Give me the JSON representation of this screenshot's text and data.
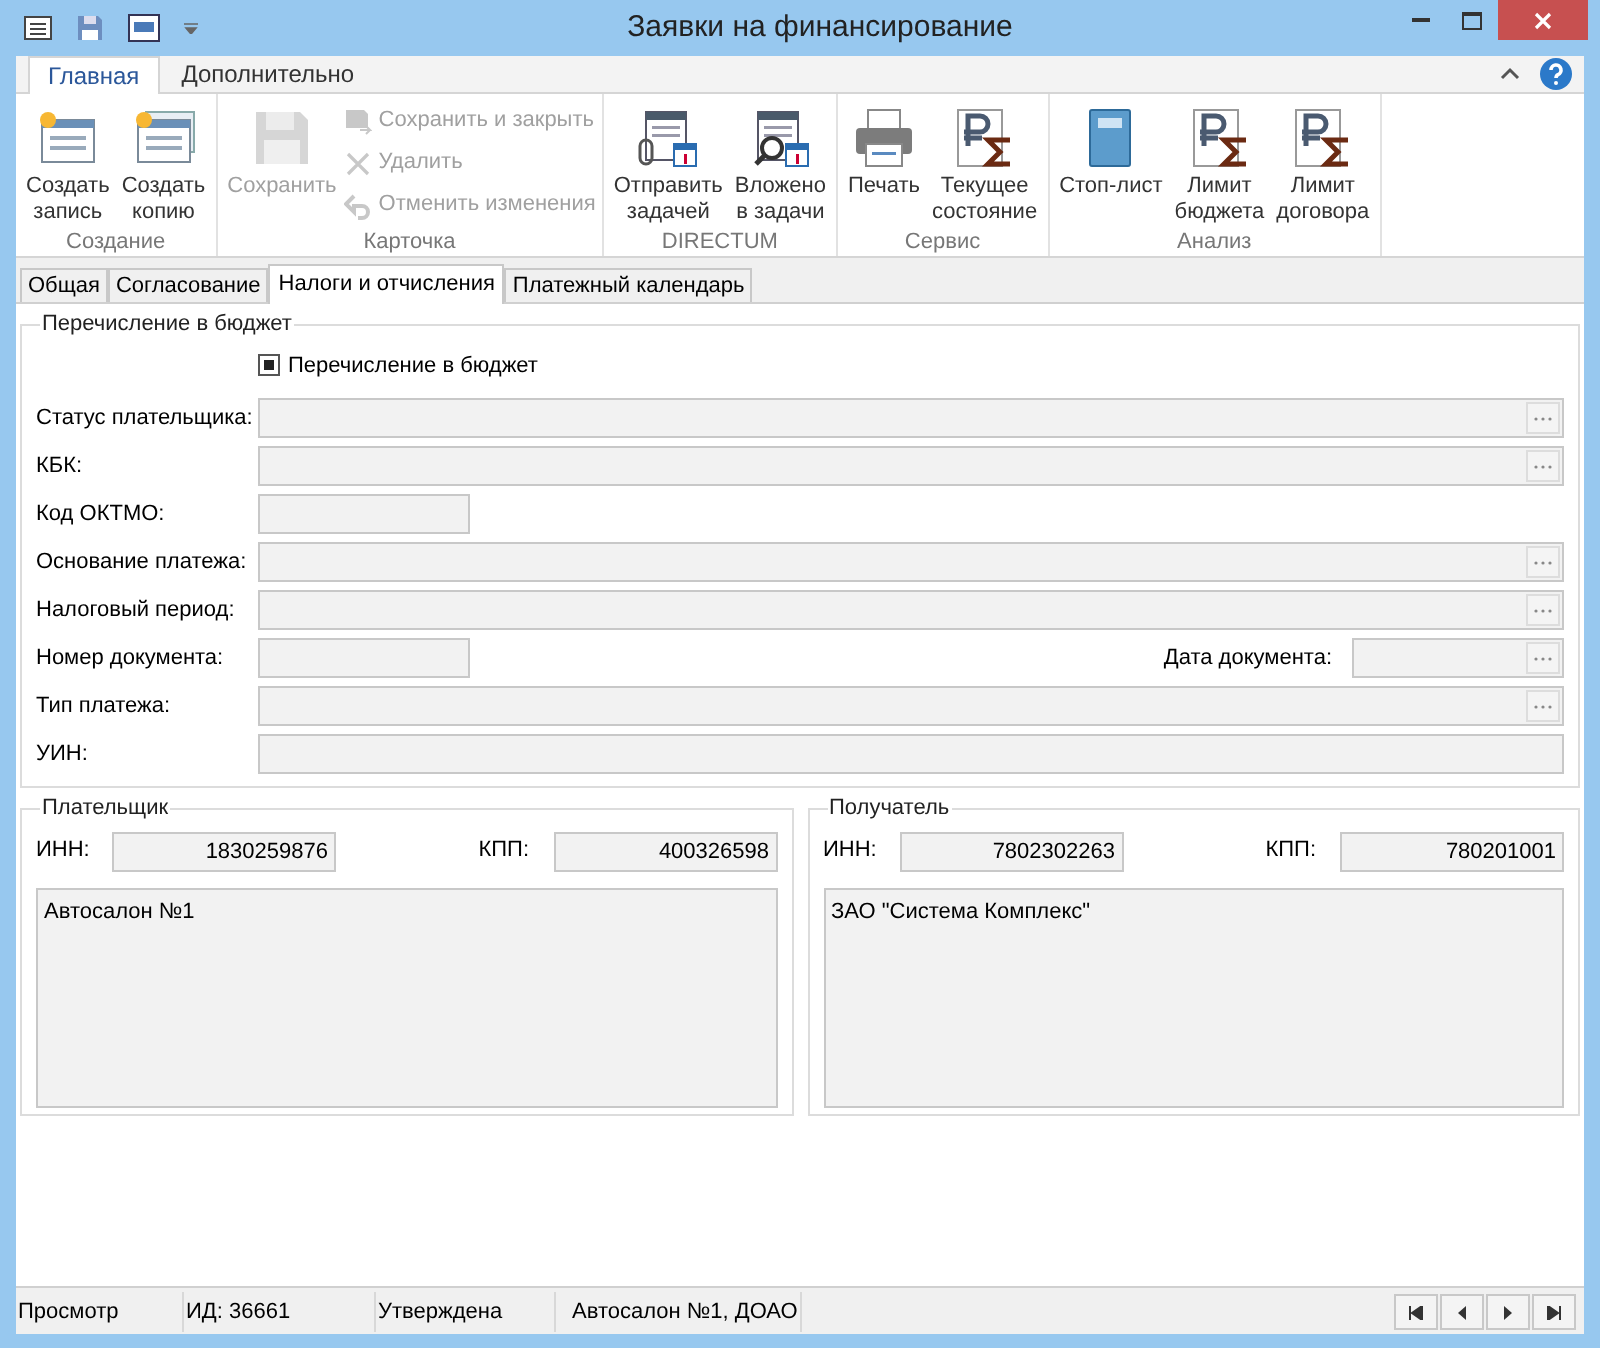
{
  "window": {
    "title": "Заявки на финансирование"
  },
  "ribbon": {
    "tabs": [
      {
        "label": "Главная",
        "selected": true
      },
      {
        "label": "Дополнительно",
        "selected": false
      }
    ],
    "groups": [
      {
        "label": "Создание",
        "items": [
          {
            "kind": "large",
            "label": "Создать\nзапись",
            "disabled": false
          },
          {
            "kind": "large",
            "label": "Создать\nкопию",
            "disabled": false
          }
        ]
      },
      {
        "label": "Карточка",
        "items": [
          {
            "kind": "large",
            "label": "Сохранить",
            "disabled": true
          },
          {
            "kind": "small",
            "label": "Сохранить и закрыть",
            "disabled": true
          },
          {
            "kind": "small",
            "label": "Удалить",
            "disabled": true
          },
          {
            "kind": "small",
            "label": "Отменить изменения",
            "disabled": true
          }
        ]
      },
      {
        "label": "DIRECTUM",
        "items": [
          {
            "kind": "large",
            "label": "Отправить\nзадачей",
            "disabled": false
          },
          {
            "kind": "large",
            "label": "Вложено\nв задачи",
            "disabled": false
          }
        ]
      },
      {
        "label": "Сервис",
        "items": [
          {
            "kind": "large",
            "label": "Печать",
            "disabled": false
          },
          {
            "kind": "large",
            "label": "Текущее\nсостояние",
            "disabled": false
          }
        ]
      },
      {
        "label": "Анализ",
        "items": [
          {
            "kind": "large",
            "label": "Стоп-лист",
            "disabled": false
          },
          {
            "kind": "large",
            "label": "Лимит\nбюджета",
            "disabled": false
          },
          {
            "kind": "large",
            "label": "Лимит\nдоговора",
            "disabled": false
          }
        ]
      }
    ]
  },
  "form_tabs": [
    {
      "label": "Общая",
      "selected": false
    },
    {
      "label": "Согласование",
      "selected": false
    },
    {
      "label": "Налоги и отчисления",
      "selected": true
    },
    {
      "label": "Платежный календарь",
      "selected": false
    }
  ],
  "budget": {
    "legend": "Перечисление в бюджет",
    "checkbox": {
      "label": "Перечисление в бюджет",
      "checked": true
    },
    "rows": [
      {
        "label": "Статус плательщика:",
        "kind": "lookup"
      },
      {
        "label": "КБК:",
        "kind": "lookup"
      },
      {
        "label": "Код ОКТМО:",
        "kind": "short"
      },
      {
        "label": "Основание платежа:",
        "kind": "lookup"
      },
      {
        "label": "Налоговый период:",
        "kind": "lookup"
      },
      {
        "label": "Номер документа:",
        "kind": "short",
        "extra": {
          "label": "Дата документа:",
          "kind": "lookup"
        }
      },
      {
        "label": "Тип платежа:",
        "kind": "lookup"
      },
      {
        "label": "УИН:",
        "kind": "text"
      }
    ]
  },
  "parties": [
    {
      "legend": "Плательщик",
      "inn_label": "ИНН:",
      "inn": "1830259876",
      "kpp_label": "КПП:",
      "kpp": "400326598",
      "name": "Автосалон №1"
    },
    {
      "legend": "Получатель",
      "inn_label": "ИНН:",
      "inn": "7802302263",
      "kpp_label": "КПП:",
      "kpp": "780201001",
      "name": "ЗАО \"Система Комплекс\""
    }
  ],
  "status_bar": [
    "Просмотр",
    "ИД: 36661",
    "Утверждена",
    "Автосалон №1, ДОАО"
  ]
}
